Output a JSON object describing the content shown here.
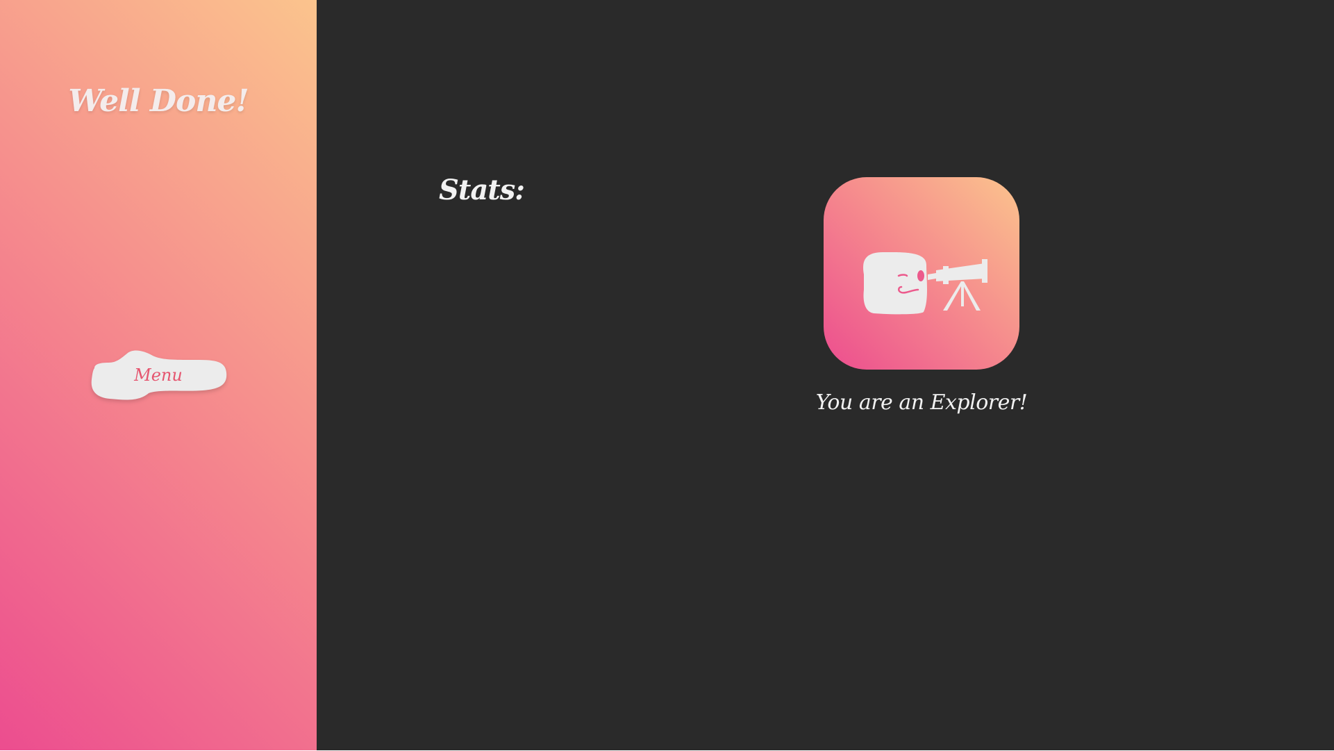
{
  "sidebar": {
    "title": "Well Done!",
    "menu_button_label": "Menu",
    "background_gradient": [
      "#ec4d8f",
      "#f5888d",
      "#fbc48d"
    ]
  },
  "main": {
    "stats_heading": "Stats:",
    "badge": {
      "icon": "explorer-telescope-icon",
      "caption": "You are an Explorer!"
    },
    "background_color": "#2a2a2a"
  },
  "colors": {
    "text_light": "#f2f2f2",
    "menu_label": "#e5556f",
    "button_fill": "#ececec"
  }
}
